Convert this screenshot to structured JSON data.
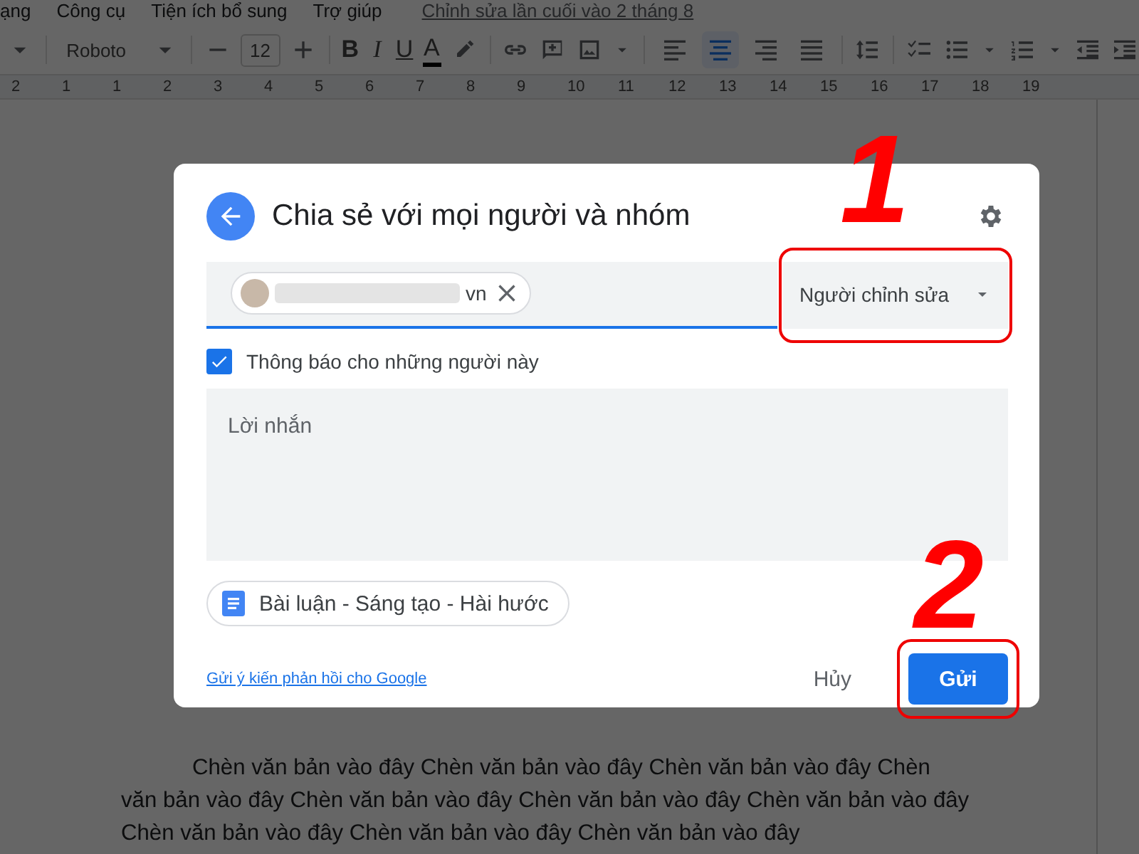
{
  "menu": {
    "items": [
      "ạng",
      "Công cụ",
      "Tiện ích bổ sung",
      "Trợ giúp"
    ],
    "last_edit": "Chỉnh sửa lần cuối vào 2 tháng 8"
  },
  "toolbar": {
    "font": "Roboto",
    "size": "12",
    "format": [
      "B",
      "I",
      "U",
      "A"
    ],
    "align": [
      {
        "kind": "left",
        "selected": false
      },
      {
        "kind": "center",
        "selected": true
      },
      {
        "kind": "right",
        "selected": false
      },
      {
        "kind": "justify",
        "selected": false
      }
    ]
  },
  "ruler": {
    "ticks": [
      "2",
      "1",
      "1",
      "2",
      "3",
      "4",
      "5",
      "6",
      "7",
      "8",
      "9",
      "10",
      "11",
      "12",
      "13",
      "14",
      "15",
      "16",
      "17",
      "18",
      "19"
    ]
  },
  "dialog": {
    "title": "Chia sẻ với mọi người và nhóm",
    "recipient": "vn",
    "role": {
      "label": "Người chỉnh sửa",
      "annotation": "1"
    },
    "notify": {
      "label": "Thông báo cho những người này",
      "checked": true
    },
    "message": {
      "placeholder": "Lời nhắn"
    },
    "file": "Bài luận - Sáng tạo - Hài hước",
    "feedback_link": "Gửi ý kiến phản hồi cho Google",
    "cancel": "Hủy",
    "send": {
      "label": "Gửi",
      "annotation": "2"
    }
  },
  "document": {
    "paragraph": "Chèn văn bản vào đây Chèn văn bản vào đây Chèn văn bản vào đây Chèn văn bản vào đây Chèn văn bản vào đây Chèn văn bản vào đây Chèn văn bản vào đây Chèn văn bản vào đây Chèn văn bản vào đây Chèn văn bản vào đây"
  }
}
